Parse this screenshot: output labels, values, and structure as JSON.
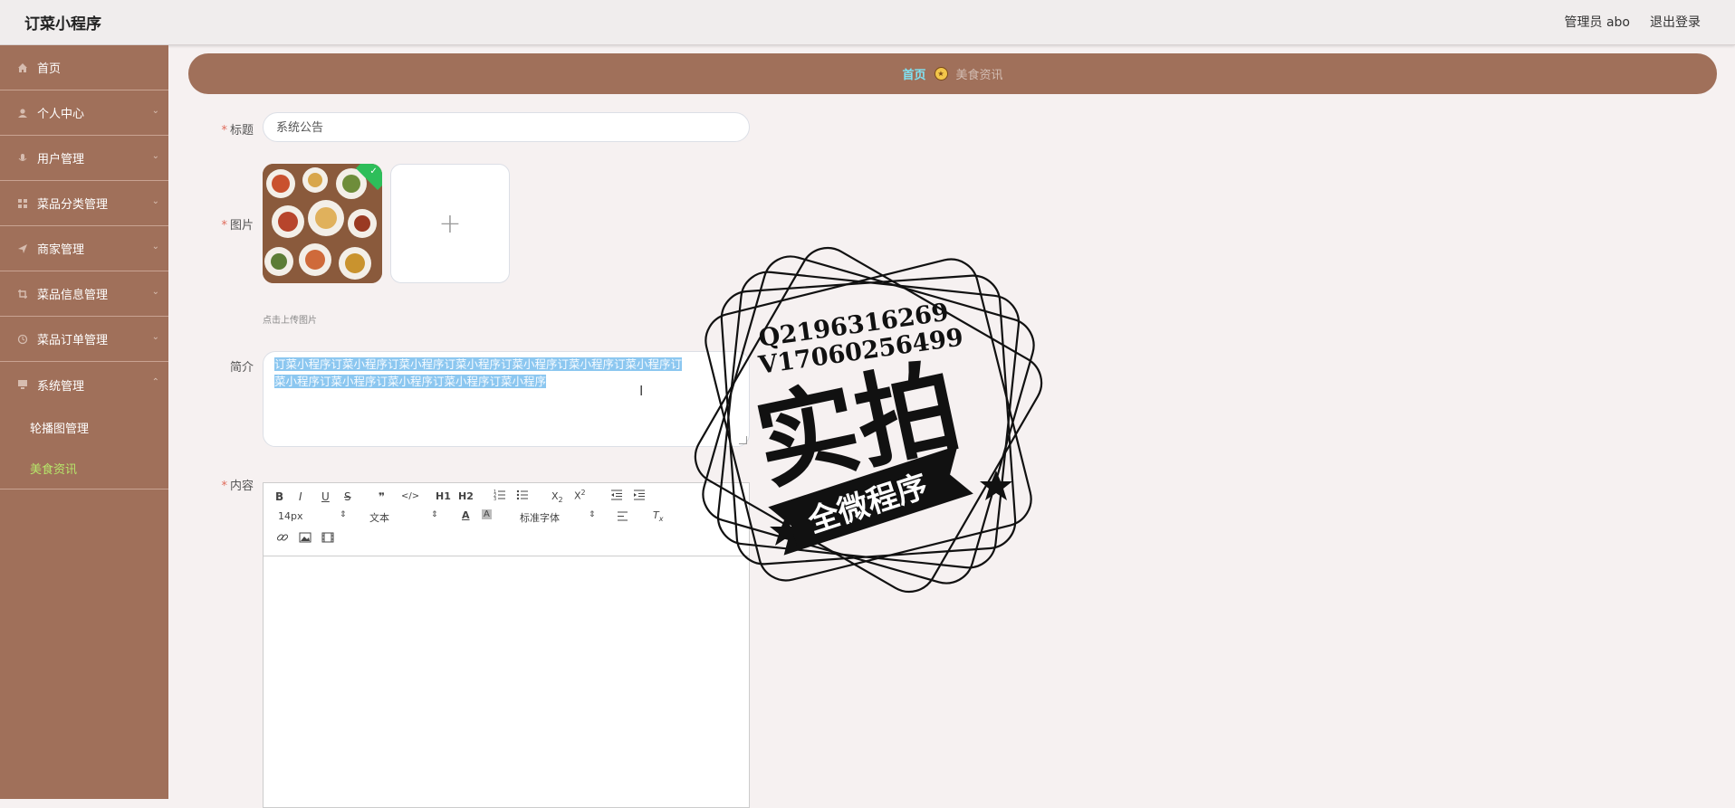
{
  "app": {
    "title": "订菜小程序"
  },
  "topbar": {
    "user_label": "管理员 abo",
    "logout_label": "退出登录"
  },
  "sidebar": {
    "items": [
      {
        "label": "首页",
        "icon": "home-icon"
      },
      {
        "label": "个人中心",
        "icon": "user-icon"
      },
      {
        "label": "用户管理",
        "icon": "mic-icon"
      },
      {
        "label": "菜品分类管理",
        "icon": "grid-icon"
      },
      {
        "label": "商家管理",
        "icon": "send-icon"
      },
      {
        "label": "菜品信息管理",
        "icon": "crop-icon"
      },
      {
        "label": "菜品订单管理",
        "icon": "clock-icon"
      },
      {
        "label": "系统管理",
        "icon": "monitor-icon"
      }
    ],
    "sub_items": [
      {
        "label": "轮播图管理",
        "active": false
      },
      {
        "label": "美食资讯",
        "active": true
      }
    ],
    "active_color": "#b6e66a"
  },
  "breadcrumb": {
    "home": "首页",
    "current": "美食资讯"
  },
  "form": {
    "title_label": "标题",
    "title_value": "系统公告",
    "image_label": "图片",
    "upload_hint": "点击上传图片",
    "intro_label": "简介",
    "intro_value_line1": "订菜小程序订菜小程序订菜小程序订菜小程序订菜小程序订菜小程序订菜小程序订",
    "intro_value_line2": "菜小程序订菜小程序订菜小程序订菜小程序订菜小程序",
    "content_label": "内容"
  },
  "editor_toolbar": {
    "font_size": "14px",
    "paragraph": "文本",
    "font_family": "标准字体",
    "buttons": [
      "B",
      "I",
      "U",
      "S",
      "❞",
      "</>",
      "H1",
      "H2",
      "ordered-list",
      "bullet-list",
      "X2",
      "X2",
      "outdent",
      "indent",
      "A",
      "A",
      "align",
      "Tx",
      "link",
      "image",
      "video"
    ]
  },
  "watermark": {
    "line1": "Q2196316269",
    "line2": "V17060256499",
    "big": "实拍",
    "banner": "全微程序"
  },
  "colors": {
    "sidebar": "#a0705a",
    "breadcrumb_home": "#7fe3f4",
    "required": "#e06c5c"
  }
}
